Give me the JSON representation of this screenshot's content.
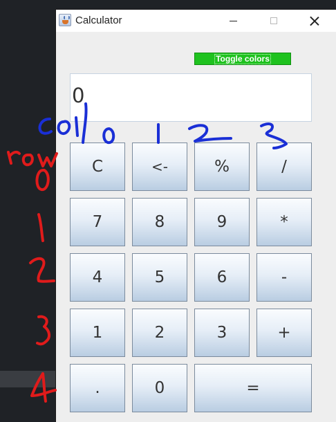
{
  "window": {
    "title": "Calculator",
    "controls": [
      "minimize",
      "maximize",
      "close"
    ]
  },
  "toggle_button": {
    "label": "Toggle colors",
    "bg_color": "#1fc21f",
    "text_color": "#ffffff"
  },
  "display": {
    "value": "0"
  },
  "keypad": {
    "row0": [
      "C",
      "<-",
      "%",
      "/"
    ],
    "row1": [
      "7",
      "8",
      "9",
      "*"
    ],
    "row2": [
      "4",
      "5",
      "6",
      "-"
    ],
    "row3": [
      "1",
      "2",
      "3",
      "+"
    ],
    "row4": [
      ".",
      "0",
      "="
    ]
  },
  "annotations": {
    "col_label": "col",
    "col_numbers": [
      "0",
      "1",
      "2",
      "3"
    ],
    "row_label": "row",
    "row_numbers": [
      "0",
      "1",
      "2",
      "3",
      "4"
    ],
    "blue_color": "#1a2fd6",
    "red_color": "#e01b1b"
  }
}
